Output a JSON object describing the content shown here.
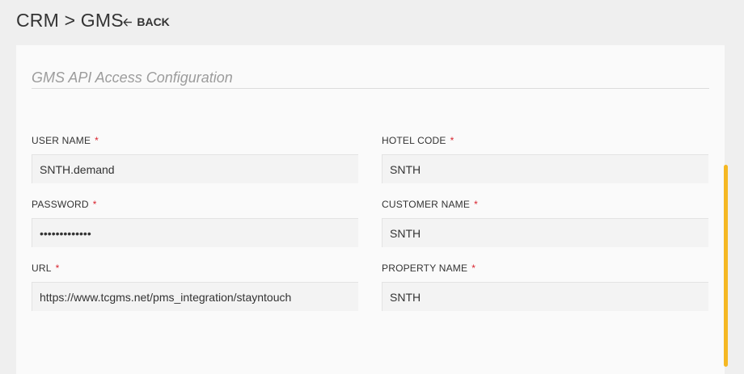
{
  "header": {
    "breadcrumb": "CRM > GMS",
    "back_label": "BACK"
  },
  "section": {
    "title": "GMS API Access Configuration"
  },
  "fields": {
    "user_name": {
      "label": "USER NAME",
      "required": "*",
      "value": "SNTH.demand"
    },
    "hotel_code": {
      "label": "HOTEL CODE",
      "required": "*",
      "value": "SNTH"
    },
    "password": {
      "label": "PASSWORD",
      "required": "*",
      "value": "•••••••••••••"
    },
    "customer_name": {
      "label": "CUSTOMER NAME",
      "required": "*",
      "value": "SNTH"
    },
    "url": {
      "label": "URL",
      "required": "*",
      "value": "https://www.tcgms.net/pms_integration/stayntouch"
    },
    "property_name": {
      "label": "PROPERTY NAME",
      "required": "*",
      "value": "SNTH"
    }
  },
  "colors": {
    "required_marker": "#d9232e",
    "scrollbar": "#f5b823"
  },
  "icons": {
    "back": "left-arrow-icon"
  }
}
